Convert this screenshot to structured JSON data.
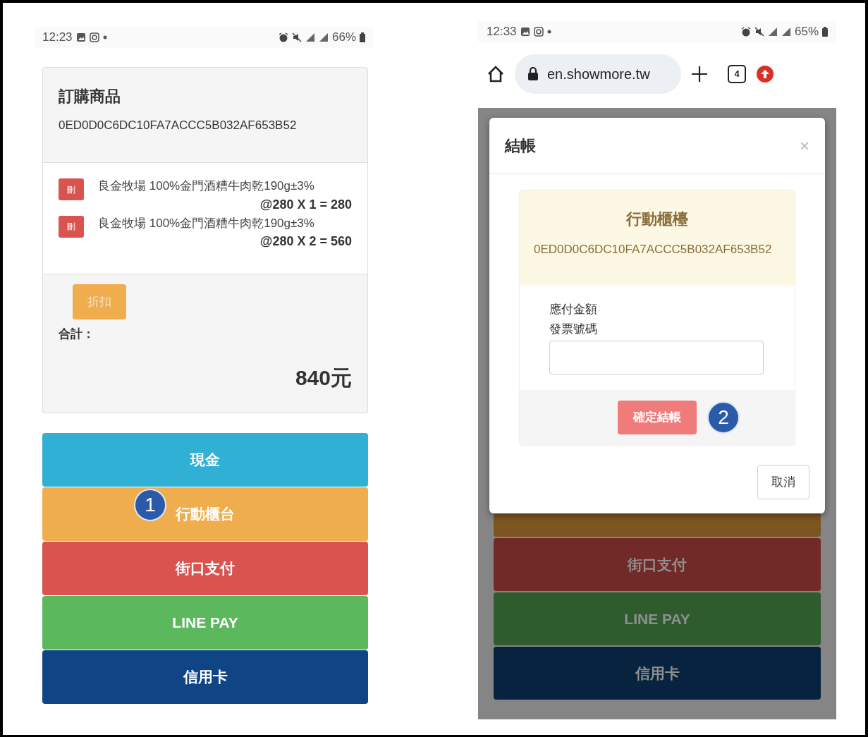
{
  "left_screen": {
    "status_bar": {
      "time": "12:23",
      "battery": "66%"
    },
    "order_card": {
      "title": "訂購商品",
      "order_id": "0ED0D0C6DC10FA7ACCC5B032AF653B52",
      "items": [
        {
          "delete_button": "刪",
          "name": "良金牧場 100%金門酒糟牛肉乾190g±3%",
          "subtotal": "@280 X 1 = 280"
        },
        {
          "delete_button": "刪",
          "name": "良金牧場 100%金門酒糟牛肉乾190g±3%",
          "subtotal": "@280 X 2 = 560"
        }
      ],
      "discount_button": "折扣",
      "total_label": "合計：",
      "total": "840元"
    },
    "payment_buttons": [
      {
        "label": "現金",
        "color": "#31b0d5"
      },
      {
        "label": "行動櫃台",
        "color": "#f0ad4e"
      },
      {
        "label": "街口支付",
        "color": "#d9534f"
      },
      {
        "label": "LINE PAY",
        "color": "#5cb85c"
      },
      {
        "label": "信用卡",
        "color": "#0f4584"
      }
    ],
    "step_marker": "1"
  },
  "right_screen": {
    "status_bar": {
      "time": "12:33",
      "battery": "65%"
    },
    "browser_bar": {
      "url": "en.showmore.tw",
      "tab_count": "4"
    },
    "payment_buttons": [
      {
        "color": "#7c5520"
      },
      {
        "label": "街口支付",
        "color": "#722a28"
      },
      {
        "label": "LINE PAY",
        "color": "#2f5c2f"
      },
      {
        "label": "信用卡",
        "color": "#08233f"
      }
    ],
    "checkout_modal": {
      "title": "結帳",
      "close_button": "×",
      "panel_title": "行動櫃檯",
      "order_id": "0ED0D0C6DC10FA7ACCC5B032AF653B52",
      "amount_label": "應付金額",
      "invoice_label": "發票號碼",
      "confirm_button": "確定結帳",
      "step_marker": "2",
      "cancel_button": "取消"
    }
  }
}
